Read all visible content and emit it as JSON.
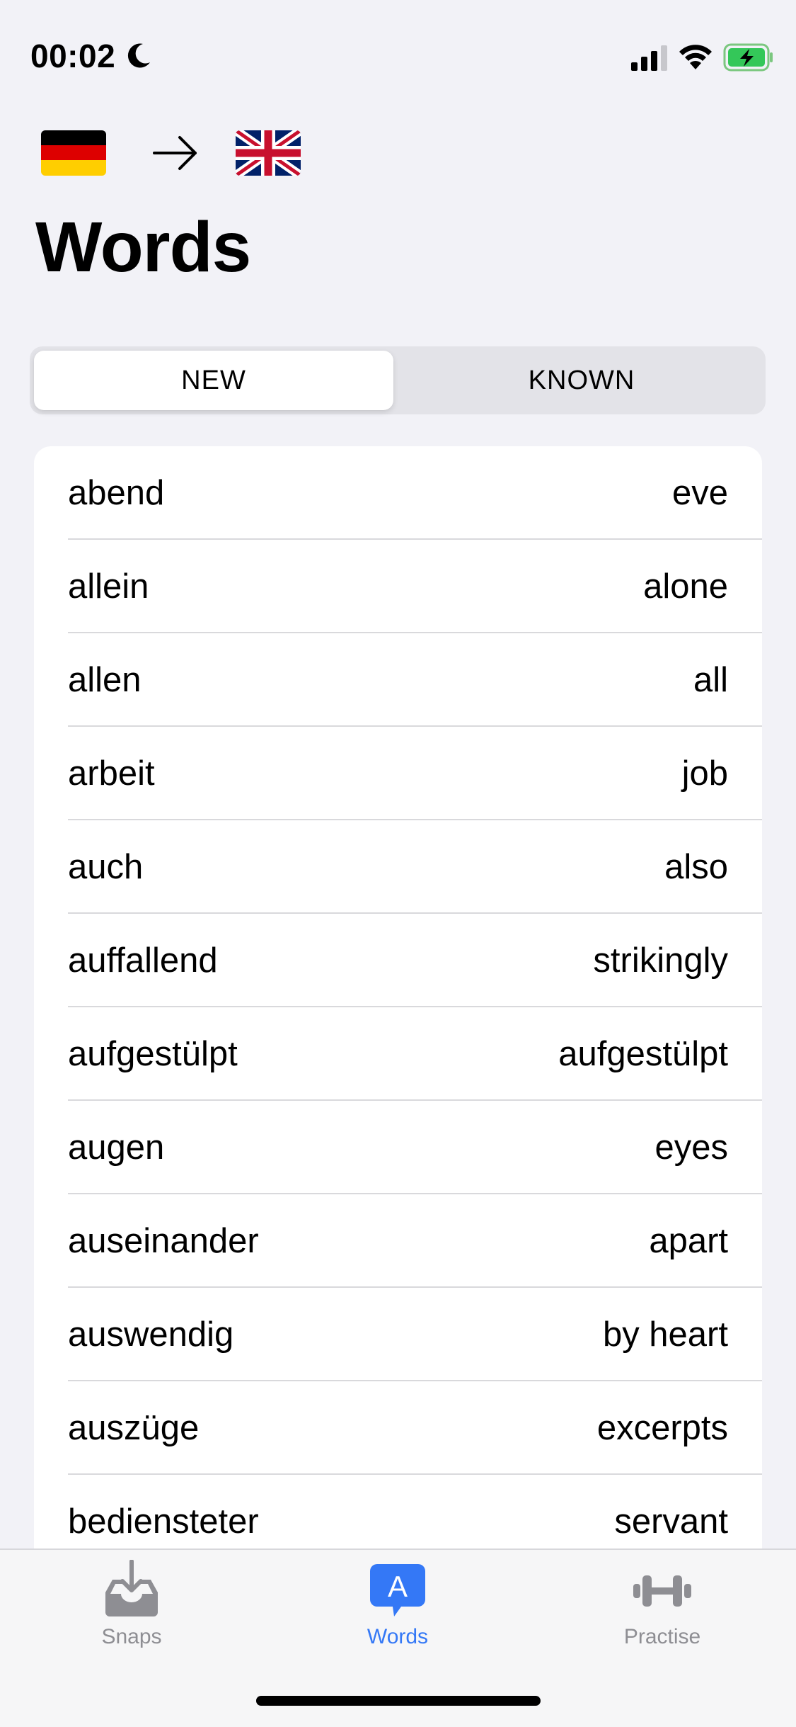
{
  "status_bar": {
    "time": "00:02",
    "icons": [
      "moon-icon",
      "signal-icon",
      "wifi-icon",
      "battery-charging-icon"
    ],
    "battery_color": "#34c759"
  },
  "language_pair": {
    "source_flag": "germany-flag-icon",
    "target_flag": "united-kingdom-flag-icon",
    "arrow": "arrow-right-icon"
  },
  "page": {
    "title": "Words"
  },
  "segmented": {
    "options": [
      "NEW",
      "KNOWN"
    ],
    "selected": "NEW"
  },
  "words": [
    {
      "term": "abend",
      "translation": "eve"
    },
    {
      "term": "allein",
      "translation": "alone"
    },
    {
      "term": "allen",
      "translation": "all"
    },
    {
      "term": "arbeit",
      "translation": "job"
    },
    {
      "term": "auch",
      "translation": "also"
    },
    {
      "term": "auffallend",
      "translation": "strikingly"
    },
    {
      "term": "aufgestülpt",
      "translation": "aufgestülpt"
    },
    {
      "term": "augen",
      "translation": "eyes"
    },
    {
      "term": "auseinander",
      "translation": "apart"
    },
    {
      "term": "auswendig",
      "translation": "by heart"
    },
    {
      "term": "auszüge",
      "translation": "excerpts"
    },
    {
      "term": "bediensteter",
      "translation": "servant"
    }
  ],
  "tab_bar": {
    "tabs": [
      {
        "label": "Snaps",
        "icon": "inbox-download-icon"
      },
      {
        "label": "Words",
        "icon": "speech-bubble-a-icon",
        "badge_letter": "A"
      },
      {
        "label": "Practise",
        "icon": "dumbbell-icon"
      }
    ],
    "active": "Words",
    "active_color": "#3478f6",
    "inactive_color": "#8e8e93"
  }
}
